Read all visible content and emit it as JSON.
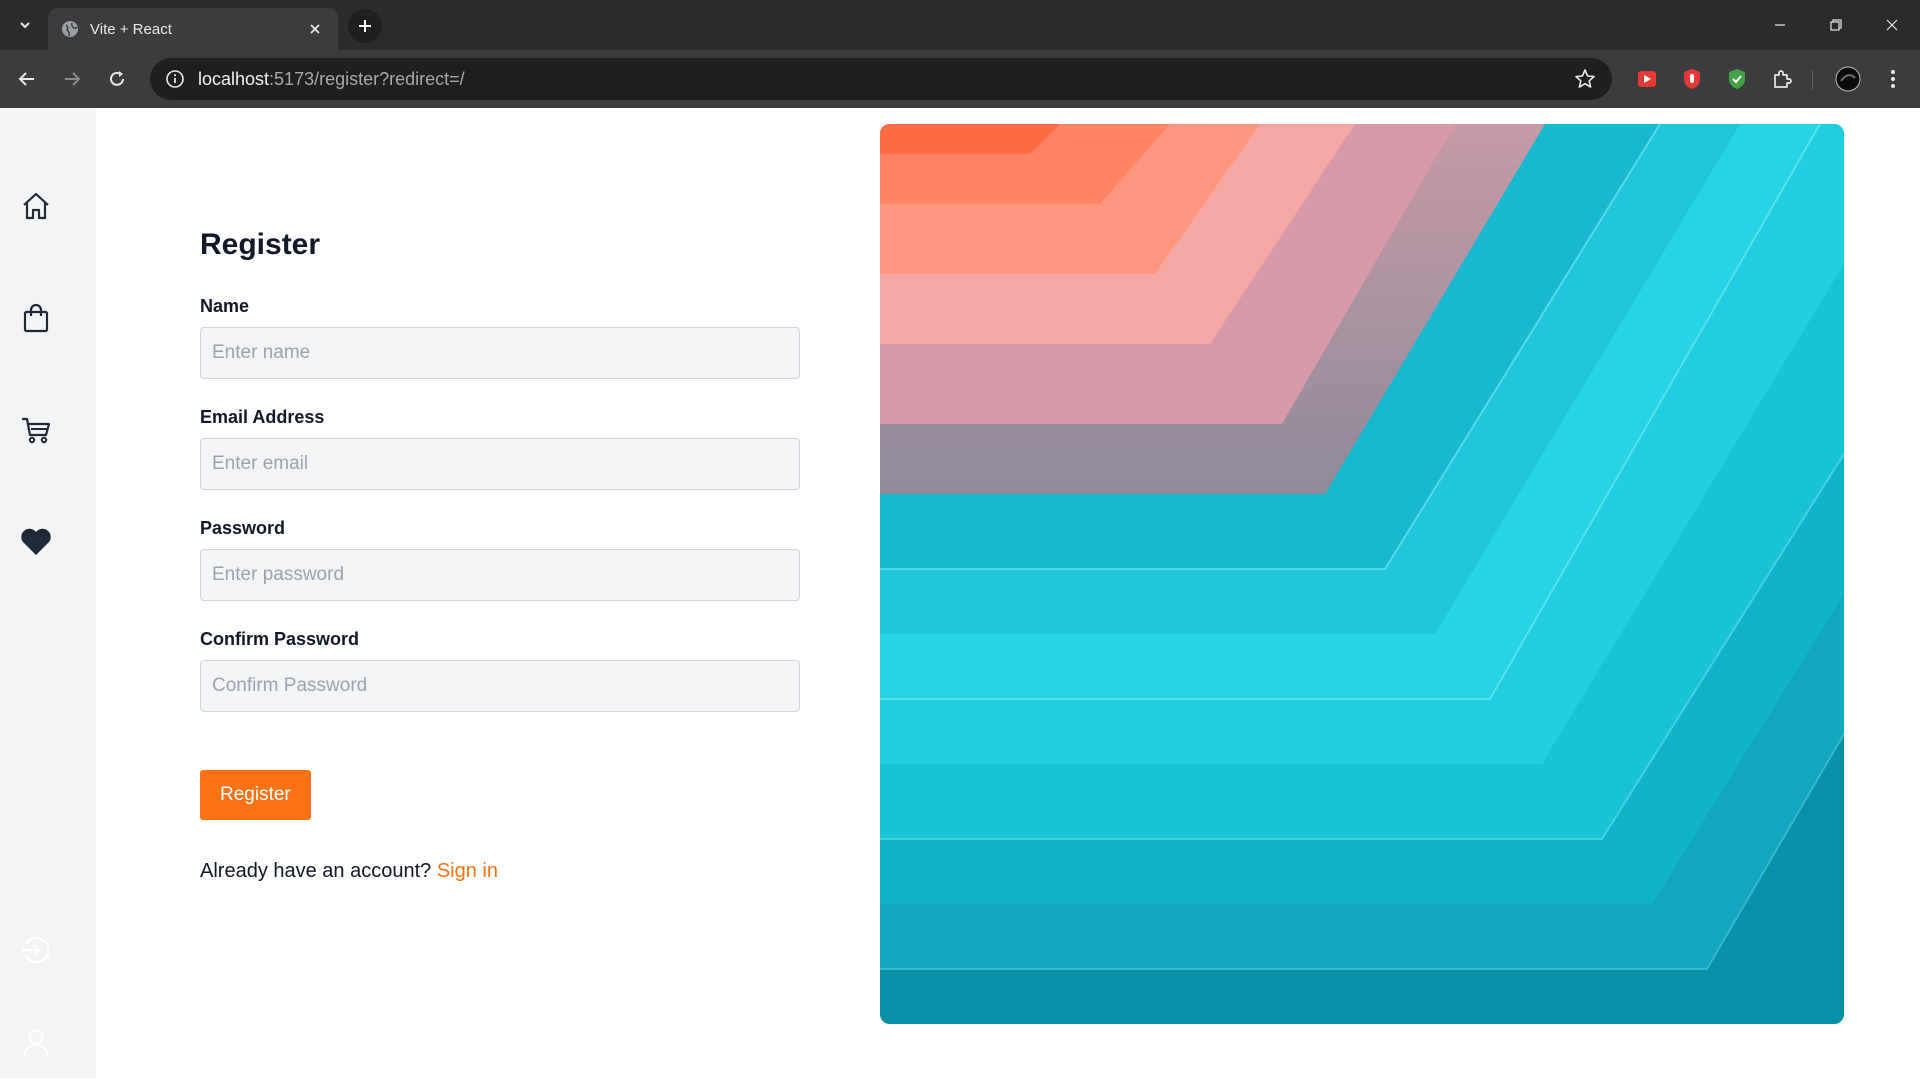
{
  "browser": {
    "tab_title": "Vite + React",
    "url_host": "localhost",
    "url_path": ":5173/register?redirect=/",
    "icons": {
      "tab_list": "chevron-down-icon",
      "favicon": "globe-icon",
      "tab_close": "close-icon",
      "new_tab": "plus-icon",
      "minimize": "minimize-icon",
      "restore": "restore-icon",
      "close_window": "close-icon",
      "back": "arrow-left-icon",
      "forward": "arrow-right-icon",
      "reload": "reload-icon",
      "site_info": "info-icon",
      "bookmark": "star-icon",
      "extensions": [
        "red-play-extension-icon",
        "red-hand-extension-icon",
        "green-shield-extension-icon",
        "puzzle-icon"
      ],
      "profile": "profile-avatar",
      "menu": "kebab-menu-icon"
    }
  },
  "sidebar": {
    "items": [
      {
        "name": "home",
        "icon": "home-icon"
      },
      {
        "name": "shop",
        "icon": "shopping-bag-icon"
      },
      {
        "name": "cart",
        "icon": "cart-icon"
      },
      {
        "name": "favorites",
        "icon": "heart-icon"
      }
    ],
    "bottom": [
      {
        "name": "login",
        "icon": "login-icon"
      },
      {
        "name": "user",
        "icon": "user-icon"
      }
    ]
  },
  "form": {
    "title": "Register",
    "fields": {
      "name": {
        "label": "Name",
        "placeholder": "Enter name"
      },
      "email": {
        "label": "Email Address",
        "placeholder": "Enter email"
      },
      "password": {
        "label": "Password",
        "placeholder": "Enter password"
      },
      "confirm": {
        "label": "Confirm Password",
        "placeholder": "Confirm Password"
      }
    },
    "submit_label": "Register",
    "signin_prompt": "Already have an account?",
    "signin_link": "Sign in"
  },
  "colors": {
    "accent": "#f97316",
    "sidebar_bg": "#f3f4f6",
    "input_bg": "#f3f4f6",
    "chrome_dark": "#2b2b2e",
    "chrome_toolbar": "#3c3c3f"
  }
}
